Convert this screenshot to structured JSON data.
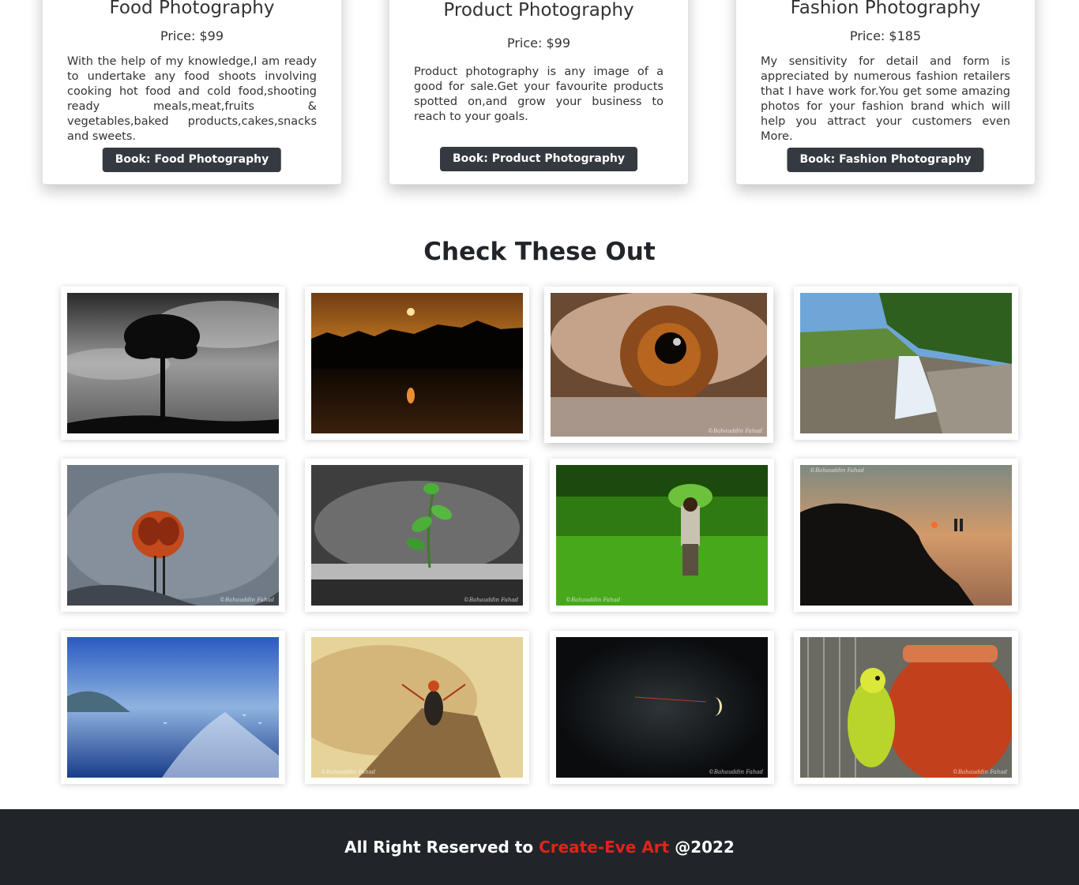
{
  "services": [
    {
      "title": "Food Photography",
      "price": "Price: $99",
      "description": "With the help of my knowledge,I am ready to undertake any food shoots involving cooking hot food and cold food,shooting ready meals,meat,fruits & vegetables,baked products,cakes,snacks and sweets.",
      "button": "Book: Food Photography"
    },
    {
      "title": "Product Photography",
      "price": "Price: $99",
      "description": "Product photography is any image of a good for sale.Get your favourite products spotted on,and grow your business to reach to your goals.",
      "button": "Book: Product Photography"
    },
    {
      "title": "Fashion Photography",
      "price": "Price: $185",
      "description": "My sensitivity for detail and form is appreciated by numerous fashion retailers that I have work for.You get some amazing photos for your fashion brand which will help you attract your customers even More.",
      "button": "Book: Fashion Photography"
    }
  ],
  "gallery": {
    "title": "Check These Out",
    "watermark": "©Bahauddin Fahad",
    "photo_subjects": [
      "tree-silhouette-bw",
      "sunset-over-lake",
      "eye-closeup",
      "waterfall",
      "fly-macro",
      "plant-sprout",
      "farmer-in-paddy",
      "beach-sunset-rocks",
      "sea-with-gulls",
      "insect-on-wood",
      "moon-night",
      "parrot-on-pot"
    ]
  },
  "footer": {
    "prefix": "All Right Reserved to",
    "brand": "Create-Eve Art",
    "suffix": "@2022",
    "brand_color": "#e3221a",
    "background": "#212529"
  }
}
